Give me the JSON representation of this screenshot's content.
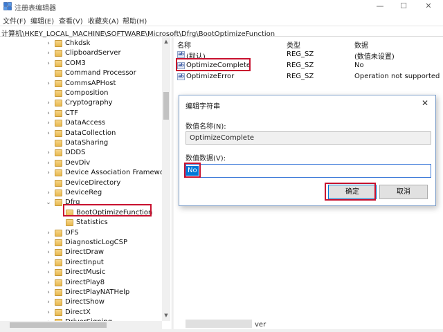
{
  "window": {
    "title": "注册表编辑器",
    "min_glyph": "—",
    "max_glyph": "☐",
    "close_glyph": "✕"
  },
  "menu": [
    "文件(F)",
    "编辑(E)",
    "查看(V)",
    "收藏夹(A)",
    "帮助(H)"
  ],
  "address": "计算机\\HKEY_LOCAL_MACHINE\\SOFTWARE\\Microsoft\\Dfrg\\BootOptimizeFunction",
  "tree": {
    "items": [
      {
        "label": "Chkdsk",
        "chevron": ">"
      },
      {
        "label": "ClipboardServer",
        "chevron": ">"
      },
      {
        "label": "COM3",
        "chevron": ">"
      },
      {
        "label": "Command Processor",
        "chevron": ""
      },
      {
        "label": "CommsAPHost",
        "chevron": ">"
      },
      {
        "label": "Composition",
        "chevron": ""
      },
      {
        "label": "Cryptography",
        "chevron": ">"
      },
      {
        "label": "CTF",
        "chevron": ">"
      },
      {
        "label": "DataAccess",
        "chevron": ">"
      },
      {
        "label": "DataCollection",
        "chevron": ">"
      },
      {
        "label": "DataSharing",
        "chevron": ""
      },
      {
        "label": "DDDS",
        "chevron": ">"
      },
      {
        "label": "DevDiv",
        "chevron": ">"
      },
      {
        "label": "Device Association Framewor",
        "chevron": ">"
      },
      {
        "label": "DeviceDirectory",
        "chevron": ""
      },
      {
        "label": "DeviceReg",
        "chevron": ">"
      },
      {
        "label": "Dfrg",
        "chevron": "v"
      },
      {
        "label": "BootOptimizeFunction",
        "chevron": ""
      },
      {
        "label": "Statistics",
        "chevron": ""
      },
      {
        "label": "DFS",
        "chevron": ">"
      },
      {
        "label": "DiagnosticLogCSP",
        "chevron": ">"
      },
      {
        "label": "DirectDraw",
        "chevron": ">"
      },
      {
        "label": "DirectInput",
        "chevron": ">"
      },
      {
        "label": "DirectMusic",
        "chevron": ">"
      },
      {
        "label": "DirectPlay8",
        "chevron": ">"
      },
      {
        "label": "DirectPlayNATHelp",
        "chevron": ">"
      },
      {
        "label": "DirectShow",
        "chevron": ">"
      },
      {
        "label": "DirectX",
        "chevron": ">"
      },
      {
        "label": "DriverSigning",
        "chevron": ">"
      }
    ]
  },
  "list": {
    "headers": {
      "name": "名称",
      "type": "类型",
      "data": "数据"
    },
    "rows": [
      {
        "name": "(默认)",
        "type": "REG_SZ",
        "data": "(数值未设置)"
      },
      {
        "name": "OptimizeComplete",
        "type": "REG_SZ",
        "data": "No"
      },
      {
        "name": "OptimizeError",
        "type": "REG_SZ",
        "data": "Operation not supported"
      }
    ],
    "icon_text": "ab"
  },
  "status": {
    "text": "ver"
  },
  "dialog": {
    "title": "编辑字符串",
    "close_glyph": "✕",
    "name_label": "数值名称(N):",
    "name_value": "OptimizeComplete",
    "data_label": "数值数据(V):",
    "data_value": "No",
    "ok_label": "确定",
    "cancel_label": "取消"
  },
  "scroll": {
    "up_glyph": "▲",
    "down_glyph": "▼"
  },
  "colors": {
    "highlight": "#c8102e",
    "selection": "#0078d7"
  }
}
